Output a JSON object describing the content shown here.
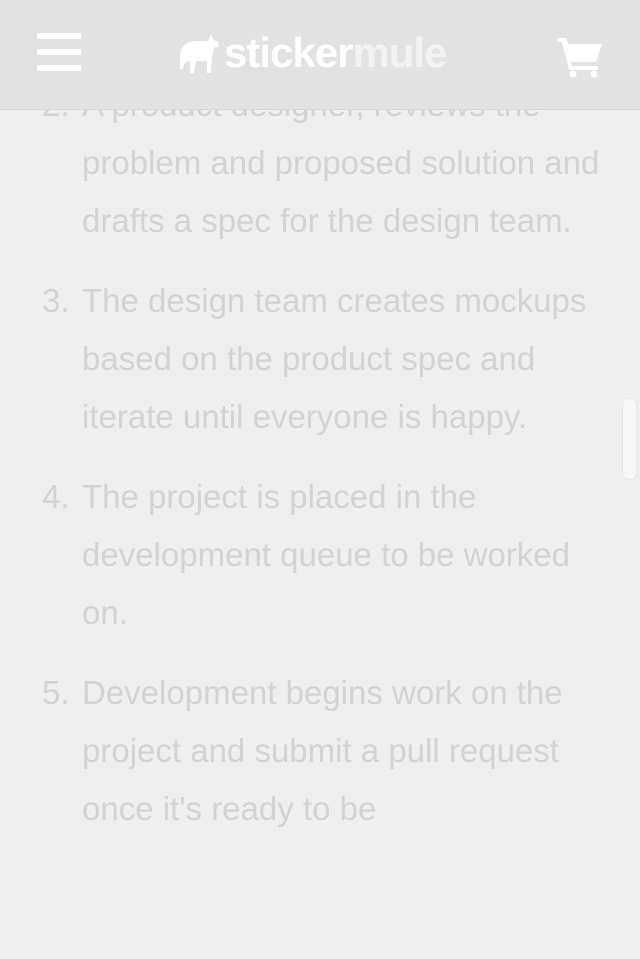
{
  "header": {
    "menu_icon": "hamburger-menu-icon",
    "logo": {
      "word1": "sticker",
      "word2": "mule",
      "icon": "mule-icon"
    },
    "cart_icon": "shopping-cart-icon"
  },
  "steps": [
    {
      "num": "2.",
      "text": "A product designer, reviews the problem and proposed solution and drafts a spec for the design team."
    },
    {
      "num": "3.",
      "text": "The design team creates mockups based on the product spec and iterate until everyone is happy."
    },
    {
      "num": "4.",
      "text": "The project is placed in the development queue to be worked on."
    },
    {
      "num": "5.",
      "text": "Development begins work on the project and submit a pull request once it's ready to be"
    }
  ],
  "colors": {
    "header_bg": "#e2e2e2",
    "page_bg": "#efefef",
    "text": "#d2d2d2",
    "logo_primary": "#ffffff"
  }
}
